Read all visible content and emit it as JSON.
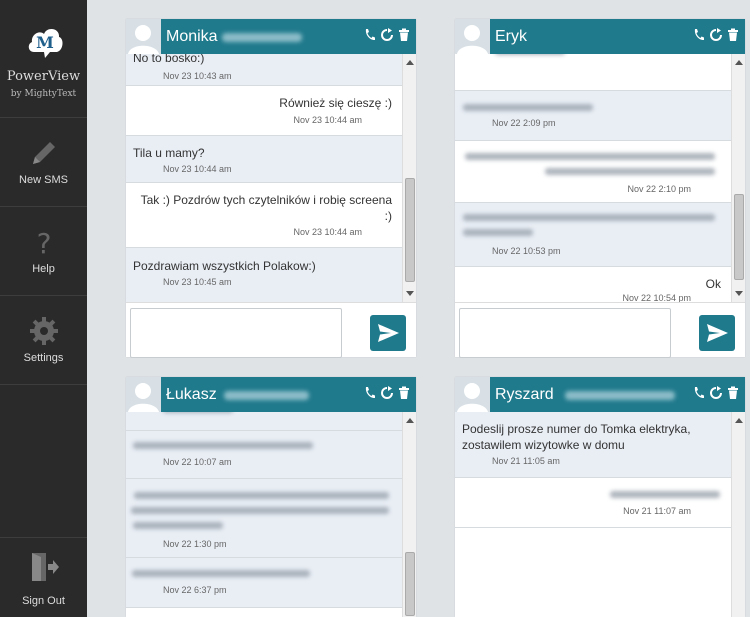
{
  "sidebar": {
    "brand_letter": "M",
    "brand_name": "PowerView",
    "brand_by": "by MightyText",
    "nav": [
      {
        "label": "New SMS",
        "icon": "pencil-icon"
      },
      {
        "label": "Help",
        "icon": "question-icon"
      },
      {
        "label": "Settings",
        "icon": "gear-icon"
      }
    ],
    "signout": {
      "label": "Sign Out",
      "icon": "sign-out-icon"
    }
  },
  "colors": {
    "accent": "#1f7a8c",
    "sidebar": "#2a2a2a",
    "incoming": "#e9eef5"
  },
  "panels": [
    {
      "name": "Monika",
      "messages": [
        {
          "text": "No to bosko:)",
          "time": "Nov 23 10:43 am",
          "dir": "in"
        },
        {
          "text": "Również się cieszę :)",
          "time": "Nov 23 10:44 am",
          "dir": "out"
        },
        {
          "text": "Tila u mamy?",
          "time": "Nov 23 10:44 am",
          "dir": "in"
        },
        {
          "text": "Tak :) Pozdrów tych czytelników i robię screena",
          "text2": ":)",
          "time": "Nov 23 10:44 am",
          "dir": "out"
        },
        {
          "text": "Pozdrawiam wszystkich Polakow:)",
          "time": "Nov 23 10:45 am",
          "dir": "in"
        }
      ]
    },
    {
      "name": "Eryk",
      "messages": [
        {
          "text": "",
          "time": "Nov 22 2:09 pm",
          "dir": "in"
        },
        {
          "text": "",
          "time": "Nov 22 2:10 pm",
          "dir": "out"
        },
        {
          "text": "",
          "time": "Nov 22 10:53 pm",
          "dir": "in"
        },
        {
          "text": "Ok",
          "time": "Nov 22 10:54 pm",
          "dir": "out"
        }
      ]
    },
    {
      "name": "Łukasz",
      "messages": [
        {
          "text": "",
          "time": "Nov 22 10:07 am",
          "dir": "in"
        },
        {
          "text": "",
          "time": "Nov 22 1:30 pm",
          "dir": "in"
        },
        {
          "text": "",
          "time": "Nov 22 6:37 pm",
          "dir": "in"
        }
      ]
    },
    {
      "name": "Ryszard",
      "messages": [
        {
          "text": "Podeslij prosze numer do Tomka elektryka,",
          "text2": "zostawilem wizytowke w domu",
          "time": "Nov 21 11:05 am",
          "dir": "in"
        },
        {
          "text": "",
          "time": "Nov 21 11:07 am",
          "dir": "out"
        }
      ]
    }
  ]
}
